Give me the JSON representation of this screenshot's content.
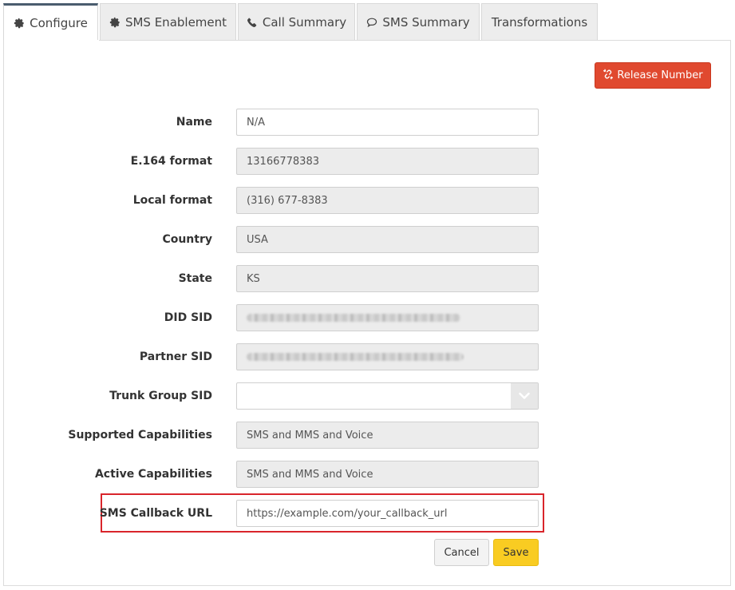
{
  "tabs": [
    {
      "label": "Configure",
      "icon": "gear-icon",
      "active": true
    },
    {
      "label": "SMS Enablement",
      "icon": "gear-icon",
      "active": false
    },
    {
      "label": "Call Summary",
      "icon": "phone-icon",
      "active": false
    },
    {
      "label": "SMS Summary",
      "icon": "chat-bubble-icon",
      "active": false
    },
    {
      "label": "Transformations",
      "icon": "",
      "active": false
    }
  ],
  "release_button": {
    "label": "Release Number",
    "icon": "unlink-icon",
    "color": "#e0492f"
  },
  "form": {
    "name": {
      "label": "Name",
      "value": "N/A"
    },
    "e164": {
      "label": "E.164 format",
      "value": "13166778383"
    },
    "local": {
      "label": "Local format",
      "value": "(316) 677-8383"
    },
    "country": {
      "label": "Country",
      "value": "USA"
    },
    "state": {
      "label": "State",
      "value": "KS"
    },
    "did_sid": {
      "label": "DID SID",
      "value": ""
    },
    "partner_sid": {
      "label": "Partner SID",
      "value": ""
    },
    "trunk_group_sid": {
      "label": "Trunk Group SID",
      "value": ""
    },
    "supported_caps": {
      "label": "Supported Capabilities",
      "value": "SMS and MMS and Voice"
    },
    "active_caps": {
      "label": "Active Capabilities",
      "value": "SMS and MMS and Voice"
    },
    "sms_callback": {
      "label": "SMS Callback URL",
      "value": "https://example.com/your_callback_url"
    }
  },
  "actions": {
    "cancel": "Cancel",
    "save": "Save"
  },
  "colors": {
    "save": "#f9cc22",
    "highlight": "#d9252b",
    "active_tab_border": "#4a5c6e"
  }
}
